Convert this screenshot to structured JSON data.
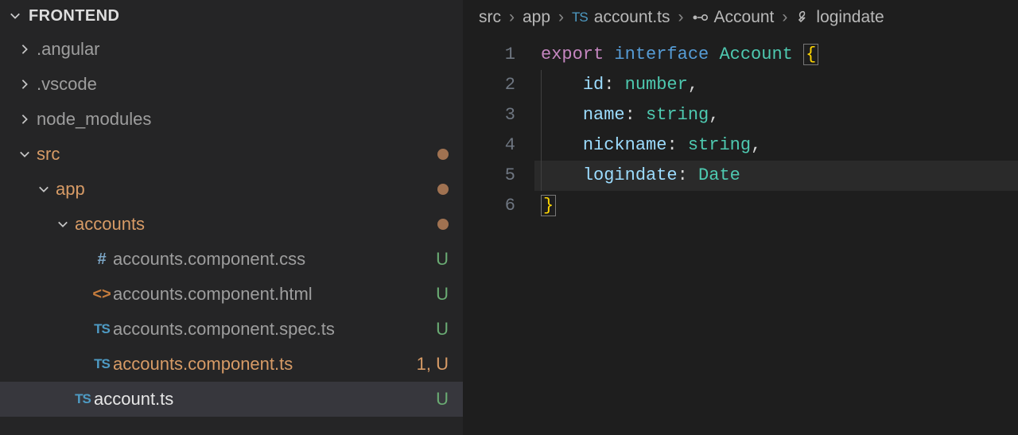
{
  "sidebar": {
    "title": "FRONTEND",
    "items": [
      {
        "depth": 0,
        "chevron": "right",
        "icon": null,
        "label": ".angular",
        "status": "",
        "style": "col-gray"
      },
      {
        "depth": 0,
        "chevron": "right",
        "icon": null,
        "label": ".vscode",
        "status": "",
        "style": "col-gray"
      },
      {
        "depth": 0,
        "chevron": "right",
        "icon": null,
        "label": "node_modules",
        "status": "",
        "style": "col-gray"
      },
      {
        "depth": 0,
        "chevron": "down",
        "icon": null,
        "label": "src",
        "status": "dot",
        "style": "col-mod"
      },
      {
        "depth": 1,
        "chevron": "down",
        "icon": null,
        "label": "app",
        "status": "dot",
        "style": "col-mod"
      },
      {
        "depth": 2,
        "chevron": "down",
        "icon": null,
        "label": "accounts",
        "status": "dot",
        "style": "col-mod"
      },
      {
        "depth": 3,
        "chevron": "",
        "icon": "hash",
        "label": "accounts.component.css",
        "status": "U",
        "style": "col-gray",
        "statusStyle": "status-u"
      },
      {
        "depth": 3,
        "chevron": "",
        "icon": "html",
        "label": "accounts.component.html",
        "status": "U",
        "style": "col-gray",
        "statusStyle": "status-u"
      },
      {
        "depth": 3,
        "chevron": "",
        "icon": "ts",
        "label": "accounts.component.spec.ts",
        "status": "U",
        "style": "col-gray",
        "statusStyle": "status-u"
      },
      {
        "depth": 3,
        "chevron": "",
        "icon": "ts",
        "label": "accounts.component.ts",
        "status": "1, U",
        "style": "col-mod",
        "statusStyle": "status-1u"
      },
      {
        "depth": 2,
        "chevron": "",
        "icon": "ts",
        "label": "account.ts",
        "status": "U",
        "style": "col-white",
        "statusStyle": "status-u",
        "selected": true
      }
    ]
  },
  "breadcrumbs": {
    "path1": "src",
    "path2": "app",
    "file": "account.ts",
    "symbol1": "Account",
    "symbol2": "logindate"
  },
  "code": {
    "currentLine": 5,
    "lines": [
      {
        "n": 1,
        "tokens": [
          {
            "t": "export",
            "c": "tok-kw"
          },
          {
            "t": " ",
            "c": ""
          },
          {
            "t": "interface",
            "c": "tok-kw2"
          },
          {
            "t": " ",
            "c": ""
          },
          {
            "t": "Account",
            "c": "tok-type"
          },
          {
            "t": " ",
            "c": ""
          },
          {
            "t": "{",
            "c": "tok-brace brace-box"
          }
        ]
      },
      {
        "n": 2,
        "tokens": [
          {
            "t": "    ",
            "c": ""
          },
          {
            "t": "id",
            "c": "tok-prop"
          },
          {
            "t": ": ",
            "c": "tok-punc"
          },
          {
            "t": "number",
            "c": "tok-type"
          },
          {
            "t": ",",
            "c": "tok-punc"
          }
        ]
      },
      {
        "n": 3,
        "tokens": [
          {
            "t": "    ",
            "c": ""
          },
          {
            "t": "name",
            "c": "tok-prop"
          },
          {
            "t": ": ",
            "c": "tok-punc"
          },
          {
            "t": "string",
            "c": "tok-type"
          },
          {
            "t": ",",
            "c": "tok-punc"
          }
        ]
      },
      {
        "n": 4,
        "tokens": [
          {
            "t": "    ",
            "c": ""
          },
          {
            "t": "nickname",
            "c": "tok-prop"
          },
          {
            "t": ": ",
            "c": "tok-punc"
          },
          {
            "t": "string",
            "c": "tok-type"
          },
          {
            "t": ",",
            "c": "tok-punc"
          }
        ]
      },
      {
        "n": 5,
        "tokens": [
          {
            "t": "    ",
            "c": ""
          },
          {
            "t": "logindate",
            "c": "tok-prop"
          },
          {
            "t": ": ",
            "c": "tok-punc"
          },
          {
            "t": "Date",
            "c": "tok-type"
          }
        ]
      },
      {
        "n": 6,
        "tokens": [
          {
            "t": "}",
            "c": "tok-brace brace-box"
          }
        ]
      }
    ]
  },
  "icons": {
    "hash": "#",
    "html": "<>",
    "ts": "TS"
  }
}
